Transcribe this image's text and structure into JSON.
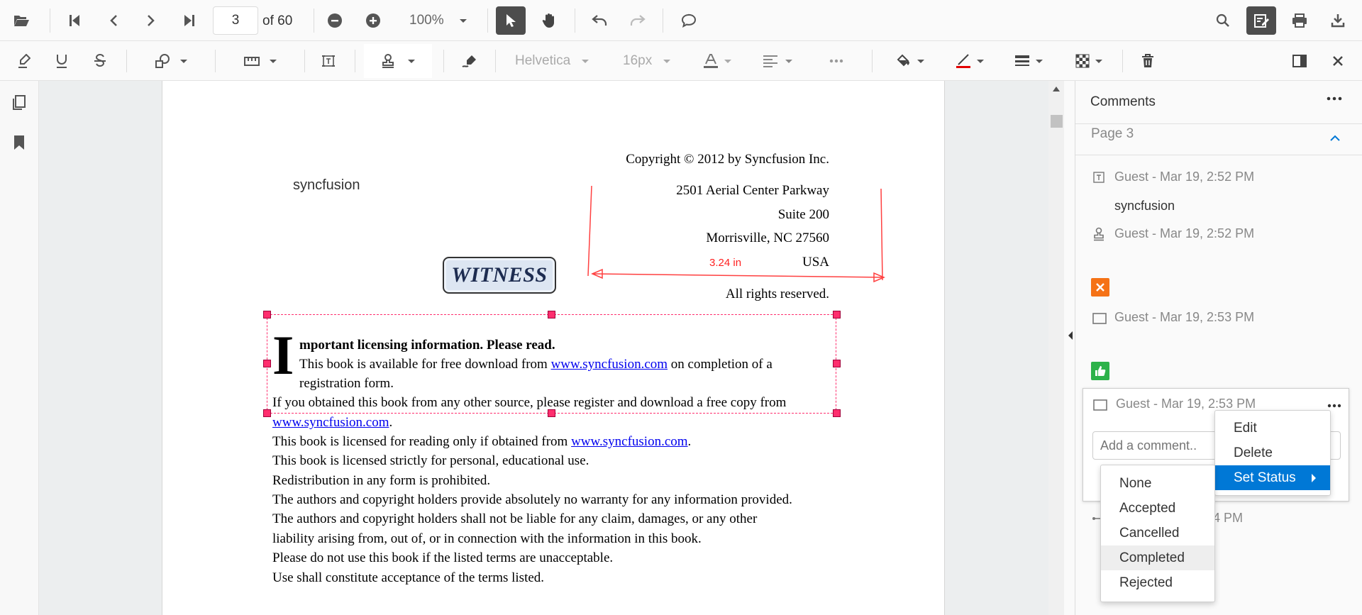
{
  "toolbar": {
    "page_number": "3",
    "page_count": "of 60",
    "zoom": "100%"
  },
  "annot_toolbar": {
    "font_family": "Helvetica",
    "font_size": "16px"
  },
  "document": {
    "stamp_text": "syncfusion",
    "witness_stamp": "WITNESS",
    "measure_label": "3.24 in",
    "copyright": "Copyright © 2012 by Syncfusion Inc.",
    "address1": "2501 Aerial Center Parkway",
    "address2": "Suite 200",
    "address3": "Morrisville, NC 27560",
    "country": "USA",
    "rights": "All rights reserved.",
    "dropcap": "I",
    "heading_rest": "mportant licensing information. Please read.",
    "line1a": "This book is available for free download from ",
    "link": "www.syncfusion.com",
    "line1b": " on completion of a",
    "line2": "registration form.",
    "line3": "If you obtained this book from any other source, please register and download a free copy from",
    "line4_dot": ".",
    "line5a": "This book is licensed for reading only if obtained from ",
    "line5_dot": ".",
    "line6": "This book is licensed strictly for personal, educational use.",
    "line7": "Redistribution in any form is prohibited.",
    "line8": "The authors and copyright holders provide absolutely no warranty for any information provided.",
    "line9": "The authors and copyright holders shall not be liable for any claim, damages, or any other",
    "line10": "liability arising from, out of, or in connection with the information in this book.",
    "line11": "Please do not use this book if the listed terms are unacceptable.",
    "line12": "Use shall constitute acceptance of the terms listed."
  },
  "comments": {
    "title": "Comments",
    "page_label": "Page 3",
    "items": [
      {
        "author": "Guest - Mar 19, 2:52 PM",
        "text": "syncfusion",
        "icon": "free-text-icon"
      },
      {
        "author": "Guest - Mar 19, 2:52 PM",
        "icon": "stamp-icon"
      },
      {
        "author": "Guest - Mar 19, 2:53 PM",
        "icon": "rectangle-icon"
      },
      {
        "author": "Guest - Mar 19, 2:53 PM",
        "icon": "rectangle-icon"
      },
      {
        "author_partial": "2:54 PM",
        "icon": "line-icon"
      }
    ],
    "add_placeholder": "Add a comment.."
  },
  "context_menu": [
    "Edit",
    "Delete",
    "Set Status"
  ],
  "status_menu": [
    "None",
    "Accepted",
    "Cancelled",
    "Completed",
    "Rejected"
  ],
  "colors": {
    "accent": "#0078d6",
    "annotation_red": "#ff0000",
    "handle": "#ff2e6e",
    "link": "#0000ee",
    "orange_badge": "#f57216",
    "green_badge": "#2db24a"
  }
}
